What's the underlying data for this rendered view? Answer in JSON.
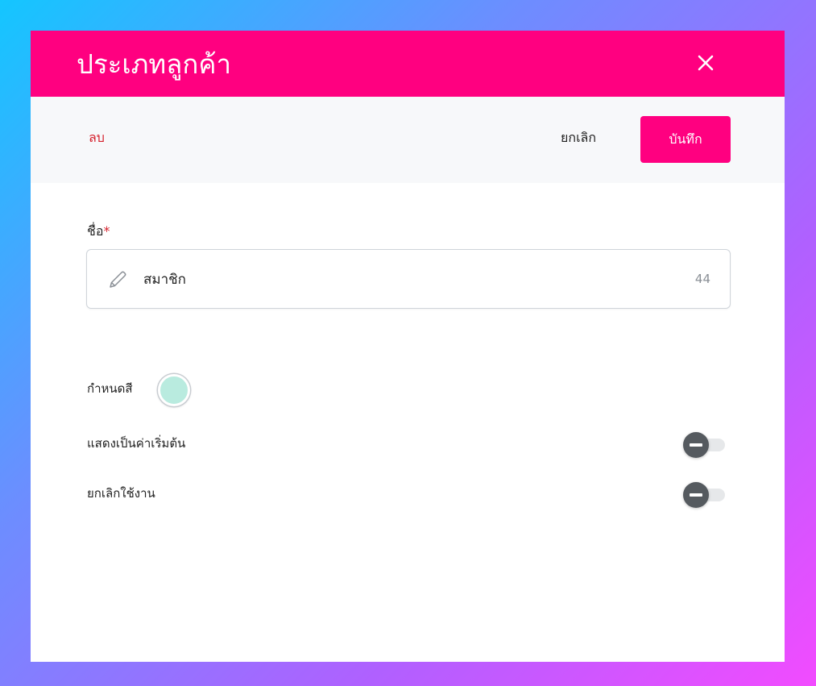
{
  "dialog": {
    "title": "ประเภทลูกค้า",
    "close_icon": "close-icon"
  },
  "toolbar": {
    "delete_label": "ลบ",
    "cancel_label": "ยกเลิก",
    "save_label": "บันทึก"
  },
  "form": {
    "name_label": "ชื่อ",
    "name_required_mark": "*",
    "name_value": "สมาชิก",
    "name_char_count": "44",
    "color_label": "กำหนดสี",
    "color_value": "#b9ebdf",
    "default_label": "แสดงเป็นค่าเริ่มต้น",
    "default_enabled": false,
    "disable_label": "ยกเลิกใช้งาน",
    "disable_enabled": false
  },
  "colors": {
    "brand": "#ff0080",
    "danger": "#d5222e",
    "toolbar_bg": "#f7f8fa"
  }
}
